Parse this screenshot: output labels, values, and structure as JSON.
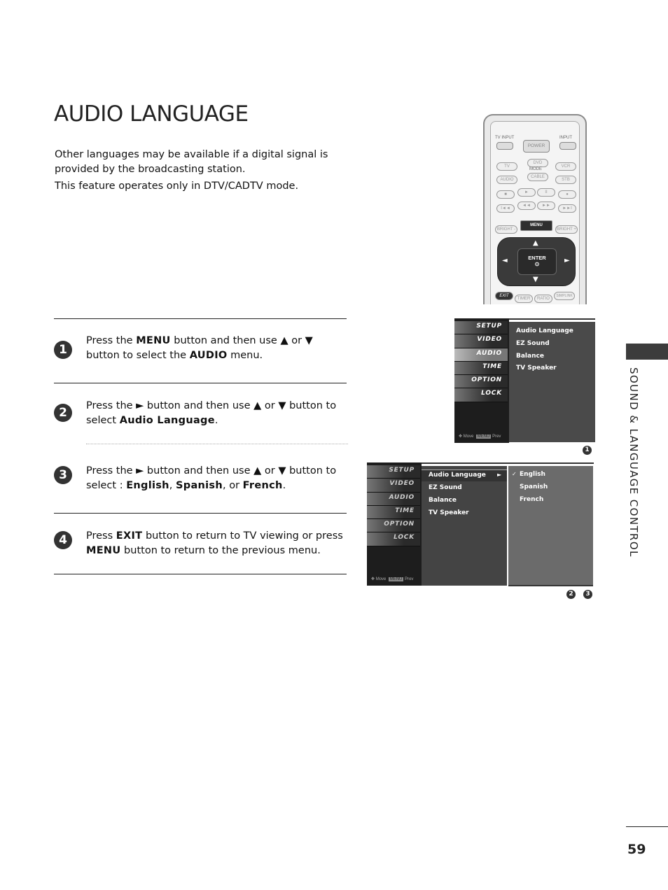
{
  "page": {
    "title": "AUDIO LANGUAGE",
    "intro": [
      "Other languages may be available if a digital signal is provided by the broadcasting station.",
      "This feature operates only in DTV/CADTV mode."
    ],
    "section_label": "SOUND & LANGUAGE CONTROL",
    "page_number": "59"
  },
  "steps": [
    {
      "num": "1",
      "parts": [
        "Press the ",
        "MENU",
        " button and then use ▲ or ▼ button to select the ",
        "AUDIO",
        " menu."
      ]
    },
    {
      "num": "2",
      "parts": [
        "Press the ► button and then use ▲ or ▼ button to select ",
        "Audio Language",
        "."
      ]
    },
    {
      "num": "3",
      "parts": [
        "Press the ► button and then use ▲ or ▼ button to select : ",
        "English",
        ", ",
        "Spanish",
        ", or ",
        "French",
        "."
      ]
    },
    {
      "num": "4",
      "parts": [
        "Press ",
        "EXIT",
        " button to return to TV viewing or press ",
        "MENU",
        " button to return to the previous menu."
      ]
    }
  ],
  "remote": {
    "tv_input": "TV INPUT",
    "input": "INPUT",
    "power": "POWER",
    "modes": [
      "TV",
      "DVD",
      "VCR",
      "AUDIO",
      "CABLE",
      "STB"
    ],
    "mode_label": "MODE",
    "transport": [
      "■",
      "►",
      "II",
      "●",
      "I◄◄",
      "◄◄",
      "►►",
      "►►I"
    ],
    "bright_minus": "BRIGHT -",
    "menu": "MENU",
    "bright_plus": "BRIGHT +",
    "enter": "ENTER",
    "enter_symbol": "⊙",
    "exit": "EXIT",
    "timer": "TIMER",
    "ratio": "RATIO",
    "simplink": "SIMPLINK"
  },
  "osd": {
    "side_menu": [
      "SETUP",
      "VIDEO",
      "AUDIO",
      "TIME",
      "OPTION",
      "LOCK"
    ],
    "footer_move": "Move",
    "footer_prev": "Prev",
    "footer_menu_tag": "MENU",
    "audio_items": [
      "Audio Language",
      "EZ Sound",
      "Balance",
      "TV Speaker"
    ],
    "language_options": [
      "English",
      "Spanish",
      "French"
    ],
    "selected_language": "English",
    "check": "✓",
    "arrow": "►",
    "screen1_badges": [
      "1"
    ],
    "screen2_badges": [
      "2",
      "3"
    ]
  }
}
